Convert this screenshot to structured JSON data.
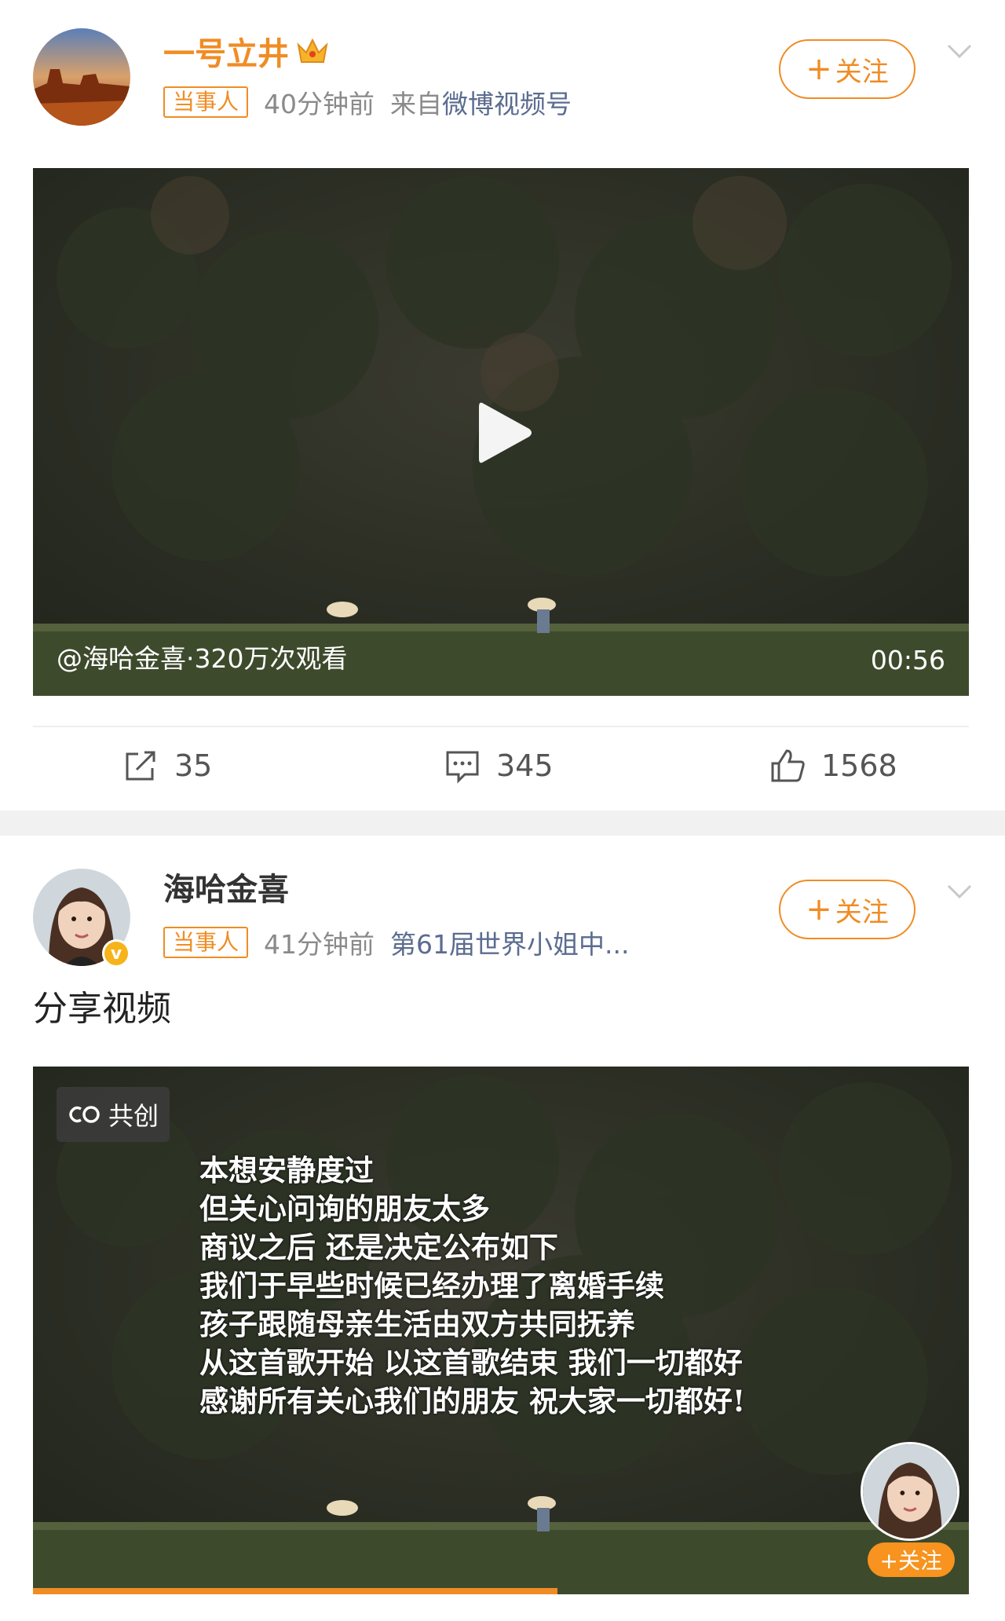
{
  "post1": {
    "username": "一号立井",
    "tag": "当事人",
    "time": "40分钟前",
    "source_prefix": "来自",
    "source_link": "微博视频号",
    "follow_label": "关注",
    "follow_plus": "+",
    "video": {
      "info": "@海哈金喜·320万次观看",
      "duration": "00:56"
    },
    "actions": {
      "repost_count": "35",
      "comment_count": "345",
      "like_count": "1568"
    }
  },
  "post2": {
    "username": "海哈金喜",
    "verified_mark": "v",
    "tag": "当事人",
    "time": "41分钟前",
    "source": "第61届世界小姐中...",
    "follow_label": "关注",
    "follow_plus": "+",
    "text": "分享视频",
    "video": {
      "cocreate_label": "共创",
      "cocreate_icon": "co-icon",
      "lyrics": [
        "本想安静度过",
        "但关心问询的朋友太多",
        "商议之后 还是决定公布如下",
        "我们于早些时候已经办理了离婚手续",
        "孩子跟随母亲生活由双方共同抚养",
        "从这首歌开始 以这首歌结束 我们一切都好",
        "感谢所有关心我们的朋友 祝大家一切都好!"
      ],
      "mini_follow_label": "+关注",
      "progress": 0.56
    }
  },
  "colors": {
    "accent": "#f08c24",
    "link": "#5b6c8f",
    "muted": "#8a8a8a"
  }
}
